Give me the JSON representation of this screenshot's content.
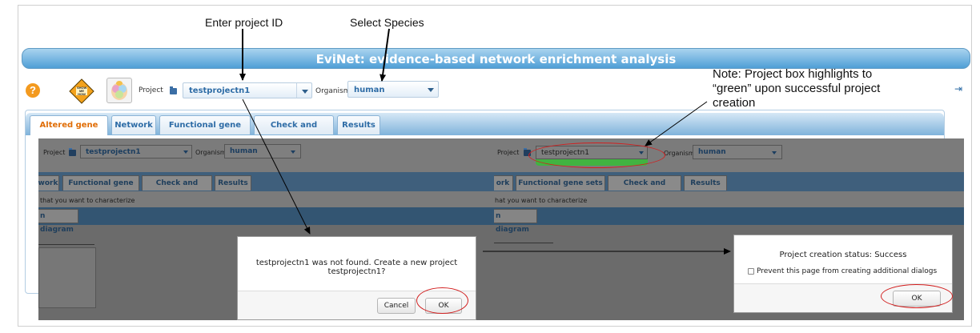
{
  "annotations": {
    "enter_project": "Enter project ID",
    "select_species": "Select Species",
    "note_line1": "Note: Project box highlights to",
    "note_line2": "“green” upon successful project",
    "note_line3": "creation"
  },
  "app": {
    "title": "EviNet: evidence-based network enrichment analysis",
    "help_icon": "?",
    "show_icon_text": "SHOW ME HOW",
    "logout_icon": "⇥"
  },
  "header": {
    "project_label": "Project",
    "project_value": "testprojectn1",
    "organism_label": "Organism",
    "organism_value": "human"
  },
  "tabs": [
    {
      "label": "Altered gene sets",
      "active": true
    },
    {
      "label": "Network",
      "active": false
    },
    {
      "label": "Functional gene sets",
      "active": false
    },
    {
      "label": "Check and submit",
      "active": false
    },
    {
      "label": "Results",
      "active": false
    }
  ],
  "left_shot": {
    "project_label": "Project",
    "project_value": "testprojectn1",
    "organism_label": "Organism",
    "organism_value": "human",
    "tabs": [
      "work",
      "Functional gene sets",
      "Check and submit",
      "Results"
    ],
    "characterize_text": "that you want to characterize",
    "subtab": "n diagram",
    "dialog_text": "testprojectn1 was not found. Create a new project testprojectn1?",
    "cancel_label": "Cancel",
    "ok_label": "OK"
  },
  "right_shot": {
    "project_label": "Project",
    "project_value": "testprojectn1",
    "organism_label": "Organism",
    "organism_value": "human",
    "tabs": [
      "ork",
      "Functional gene sets",
      "Check and submit",
      "Results"
    ],
    "characterize_text": "hat you want to characterize",
    "subtab": "n diagram",
    "dialog_status": "Project creation status: Success",
    "checkbox_label": "Prevent this page from creating additional dialogs",
    "ok_label": "OK"
  },
  "colors": {
    "banner": "#4f9fd6",
    "accent_text": "#2e6ca6",
    "active_tab": "#e06d06",
    "highlight_green": "#41b341",
    "annotation_red": "#d21f1f"
  }
}
